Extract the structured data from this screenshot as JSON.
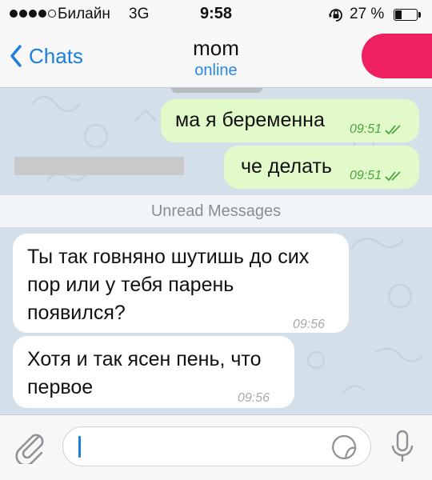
{
  "status_bar": {
    "carrier": "Билайн",
    "network": "3G",
    "time": "9:58",
    "battery_percent": "27 %",
    "battery_level": 0.27,
    "signal_strength": 4,
    "icons": [
      "signal-dots-icon",
      "orientation-lock-icon",
      "battery-icon"
    ]
  },
  "header": {
    "back_label": "Chats",
    "title": "mom",
    "subtitle": "online",
    "icons": [
      "chevron-left-icon"
    ]
  },
  "messages": {
    "outgoing_1": {
      "text": "ма я беременна",
      "time": "09:51",
      "status": "read"
    },
    "outgoing_2": {
      "text": "че делать",
      "time": "09:51",
      "status": "read"
    },
    "unread_divider": "Unread Messages",
    "incoming_1": {
      "lines": [
        "Ты так говняно шутишь до сих",
        "пор или у тебя парень",
        "появился?"
      ],
      "time": "09:56"
    },
    "incoming_2": {
      "lines": [
        "Хотя и так ясен пень, что",
        "первое"
      ],
      "time": "09:56"
    }
  },
  "input_bar": {
    "placeholder": "",
    "icons": [
      "paperclip-icon",
      "sticker-icon",
      "microphone-icon"
    ]
  },
  "colors": {
    "accent": "#1a7fde",
    "outgoing_bubble": "#e2fac9",
    "incoming_bubble": "#ffffff",
    "chat_background": "#d3dfe9",
    "read_checks": "#4aa53f",
    "redaction": "#ee2060"
  }
}
